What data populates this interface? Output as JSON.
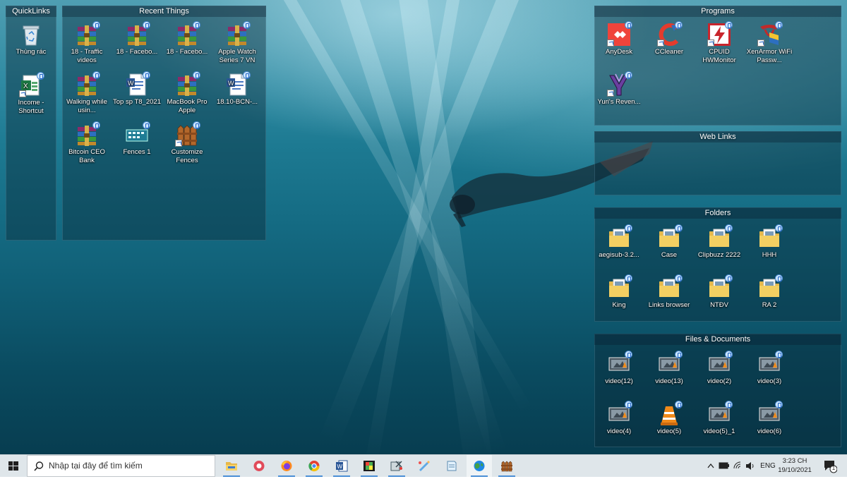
{
  "fences": {
    "quicklinks": {
      "title": "QuickLinks",
      "items": [
        {
          "label": "Thùng rác",
          "icon": "recycle-bin-icon"
        },
        {
          "label": "Income - Shortcut",
          "icon": "excel-file-icon"
        }
      ]
    },
    "recent": {
      "title": "Recent Things",
      "items": [
        {
          "label": "18 - Traffic videos",
          "icon": "winrar-archive-icon"
        },
        {
          "label": "18 - Facebo...",
          "icon": "winrar-archive-icon"
        },
        {
          "label": "18 - Facebo...",
          "icon": "winrar-archive-icon"
        },
        {
          "label": "Apple Watch Series 7 VN",
          "icon": "winrar-archive-icon"
        },
        {
          "label": "Walking while usin...",
          "icon": "winrar-archive-icon"
        },
        {
          "label": "Top sp T8_2021",
          "icon": "word-document-icon"
        },
        {
          "label": "MacBook Pro Apple",
          "icon": "winrar-archive-icon"
        },
        {
          "label": "18.10-BCN-...",
          "icon": "word-document-icon"
        },
        {
          "label": "Bitcoin CEO Bank",
          "icon": "winrar-archive-icon"
        },
        {
          "label": "Fences 1",
          "icon": "fences-snapshot-icon"
        },
        {
          "label": "Customize Fences",
          "icon": "fences-app-icon"
        }
      ]
    },
    "programs": {
      "title": "Programs",
      "items": [
        {
          "label": "AnyDesk",
          "icon": "anydesk-icon"
        },
        {
          "label": "CCleaner",
          "icon": "ccleaner-icon"
        },
        {
          "label": "CPUID HWMonitor",
          "icon": "hwmonitor-icon"
        },
        {
          "label": "XenArmor WiFi Passw...",
          "icon": "xenarmor-icon"
        },
        {
          "label": "Yuri's Reven...",
          "icon": "yuris-revenge-icon"
        }
      ]
    },
    "weblinks": {
      "title": "Web Links",
      "items": []
    },
    "folders": {
      "title": "Folders",
      "items": [
        {
          "label": "aegisub-3.2...",
          "icon": "folder-icon"
        },
        {
          "label": "Case",
          "icon": "folder-icon"
        },
        {
          "label": "Clipbuzz 2222",
          "icon": "folder-icon"
        },
        {
          "label": "HHH",
          "icon": "folder-icon"
        },
        {
          "label": "King",
          "icon": "folder-icon"
        },
        {
          "label": "Links browser",
          "icon": "folder-icon"
        },
        {
          "label": "NTĐV",
          "icon": "folder-icon"
        },
        {
          "label": "RA 2",
          "icon": "folder-icon"
        }
      ]
    },
    "files": {
      "title": "Files & Documents",
      "items": [
        {
          "label": "video(12)",
          "icon": "video-file-icon"
        },
        {
          "label": "video(13)",
          "icon": "video-file-icon"
        },
        {
          "label": "video(2)",
          "icon": "video-file-icon"
        },
        {
          "label": "video(3)",
          "icon": "video-file-icon"
        },
        {
          "label": "video(4)",
          "icon": "video-file-icon"
        },
        {
          "label": "video(5)",
          "icon": "vlc-file-icon"
        },
        {
          "label": "video(5)_1",
          "icon": "video-file-icon"
        },
        {
          "label": "video(6)",
          "icon": "video-file-icon"
        }
      ]
    }
  },
  "taskbar": {
    "search_placeholder": "Nhập tại đây để tìm kiếm",
    "apps": [
      {
        "name": "file-explorer-icon",
        "running": true
      },
      {
        "name": "screen-recorder-icon",
        "running": false
      },
      {
        "name": "firefox-icon",
        "running": true
      },
      {
        "name": "chrome-icon",
        "running": true
      },
      {
        "name": "word-icon",
        "running": true
      },
      {
        "name": "movie-maker-icon",
        "running": true
      },
      {
        "name": "snipping-tool-icon",
        "running": true
      },
      {
        "name": "paint-icon",
        "running": false
      },
      {
        "name": "notepad-icon",
        "running": false
      },
      {
        "name": "network-globe-icon",
        "running": true
      },
      {
        "name": "fences-icon",
        "running": true
      }
    ],
    "tray": {
      "language": "ENG",
      "time": "3:23 CH",
      "date": "19/10/2021",
      "notification_count": "1"
    }
  },
  "colors": {
    "fence_bg": "#0a2837",
    "taskbar_bg": "#dfe6ea",
    "accent": "#4a8fd6"
  }
}
